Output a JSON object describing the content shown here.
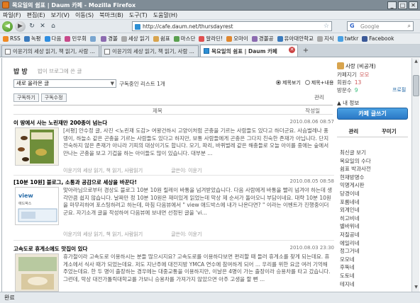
{
  "window": {
    "title": "목요일의 쉼표 | Daum 카페 - Mozilla Firefox",
    "min": "_",
    "max": "□",
    "close": "✕"
  },
  "menu": [
    "파일(F)",
    "편집(E)",
    "보기(V)",
    "이동(S)",
    "북마크(B)",
    "도구(T)",
    "도움말(H)"
  ],
  "nav": {
    "back": "◀",
    "forward": "▶",
    "reload": "↻",
    "stop": "✕",
    "home": "⌂",
    "url": "http://cafe.daum.net/thursdayrest",
    "search_placeholder": "Google",
    "star": "☆",
    "search_glyph": "⌕",
    "google_mark": "G"
  },
  "bookmarks": [
    {
      "label": "RSS",
      "color": "#f08a24"
    },
    {
      "label": "녹평",
      "color": "#3b7bbd"
    },
    {
      "label": "다음",
      "color": "#2f8ee0"
    },
    {
      "label": "민우회",
      "color": "#c84a8a"
    },
    {
      "label": "",
      "color": "#7aa6d0"
    },
    {
      "label": "경볼",
      "color": "#8c6bb0"
    },
    {
      "label": "세상 읽기",
      "color": "#aaaaaa"
    },
    {
      "label": "쉼표",
      "color": "#d8a44e"
    },
    {
      "label": "마스단",
      "color": "#5aa050"
    },
    {
      "label": "알라딘!",
      "color": "#e05050"
    },
    {
      "label": "오마이",
      "color": "#e08830"
    },
    {
      "label": "경볼공",
      "color": "#8c6bb0"
    },
    {
      "label": "유아대안학교",
      "color": "#3b7bbd"
    },
    {
      "label": "지식",
      "color": "#aaaaaa"
    },
    {
      "label": "twtkr",
      "color": "#4aa0e2"
    },
    {
      "label": "Facebook",
      "color": "#3b5998"
    }
  ],
  "tabs": [
    {
      "label": "이윤기의 세상 읽기, 책 읽기, 사람 ..."
    },
    {
      "label": "이윤기의 세상 읽기, 책 읽기, 사람 ..."
    },
    {
      "label": "목요일의 쉼표 | Daum 카페",
      "active": true
    }
  ],
  "tabs_new": "+",
  "page": {
    "blog_title": "밥 방",
    "blog_sub": "밥이 브로그에 쓴 글",
    "select_value": "새로 올라온 글",
    "subscribe_text": "구독중인 리스트 1개",
    "radio1": "제목보기",
    "radio2": "제목+내용",
    "btn_manage_sub": "구독하기",
    "btn_subscribe_setting": "구독수정",
    "manage": "관리",
    "col_title": "제목",
    "col_author": "작성일"
  },
  "posts": [
    {
      "title": "이 땅에서 사는 노린재만 200종이 넘는다",
      "date": "2010.08.06 08:57",
      "body": "[서평] 안수정 글, 사진 <노린재 도감> 여왕건하시 고양이처럼 곤충을 기르는 사람들도 있다고 하더군요. 사슴벌레나 풍뎅이, 하늘소 같은 곤충을 기르는 사람들도 있다고 하지만, 보통 사람들에게 곤충은 그다지 친숙한 존재가 아닙니다. 단지 전숙하지 않은 존재가 아니라 기피의 대상이기도 합니다. 모기, 파리, 바퀴벌레 같은 해충들로 오늘 아이를 중에는 숲에서 만나는 곤충을 보고 기겁을 하는 아이들도 많이 있습니다. 대부분 ...",
      "meta1": "이윤기의 세상 읽기, 책 읽기, 사람읽기",
      "meta2": "글쓴이: 이윤기"
    },
    {
      "title": "[10분 10원] 블로그, 소통과 공감으로 세상을 바꾼다!",
      "date": "2010.08.05 08:58",
      "body": "맞아라님으로부터 경상도 블로그 10분 10원 릴레이 바통을 넘겨받았습니다. 다음 사람에게 바통을 빨리 넘겨야 하는데 생각만큼 쉽지 않습니다. 날짜만 정 10분 10원은 재미있게 읽었는데 막상 제 순서가 돌아오니 부담이네요. 대략 10분 10원을 마무리하여 포스팅하려고 하는데, 마침 다음뷰에서 \" view 애드박스에 내가 나온다면? \" 이라는 이벤트가 진행중이더군요. 자기소개 글을 작성하여 다음뷰에 보내면 선정된 글을 'vi...",
      "meta1": "이윤기의 세상 읽기, 책 읽기, 사람읽기",
      "meta2": "글쓴이: 이윤기"
    },
    {
      "title": "고속도로 휴게소에도 맛집이 있다",
      "date": "2010.08.03 23:30",
      "body": "휴가철이라 고속도로 이용하시는 분들 많으시지요? 고속도로를 이용하다보면 편리할 때 들러 휴게소를 찾게 되는데요. 휴게소에서 식사 때가 되었는데요. 저도 지난주에 대전지방 YMCA 연수에 참여하게 되어 ... 우리를 위한 요금 여러 기억해 주었는데요. 한 두 명이 출장하는 경우에는 대중교통을 이용하지만, 이날은 4명이 가는 출장이라 승용차를 타고 갔습니다. 그런데, 막상 대전가톨릭대학교를 가보니 승용차를 가져가지 않았으면 아주 고생을 할 뻔 ...",
      "meta1": "",
      "meta2": ""
    }
  ],
  "sidebar": {
    "name": "사랑 (비공개)",
    "rows": [
      {
        "label": "카페지기",
        "value": "모모"
      },
      {
        "label": "회원수",
        "value": "13"
      },
      {
        "label": "방문수",
        "value": "9"
      }
    ],
    "profile_link": "프로필",
    "my_info": "▲ 내 정보",
    "write_btn": "카페 글쓰기",
    "tab1": "관리",
    "tab2": "꾸미기",
    "list": [
      "최신글 보기",
      "목요일의 수다",
      "쉼표 박과사전",
      "현재방명수",
      "익명게시판",
      "당경이네",
      "포룸네네",
      "외계인네",
      "히고비네",
      "별바위네",
      "저질공네",
      "에일리네",
      "정그거네",
      "모모네",
      "후뚝네",
      "도토네",
      "테지네"
    ]
  },
  "status": "완료"
}
